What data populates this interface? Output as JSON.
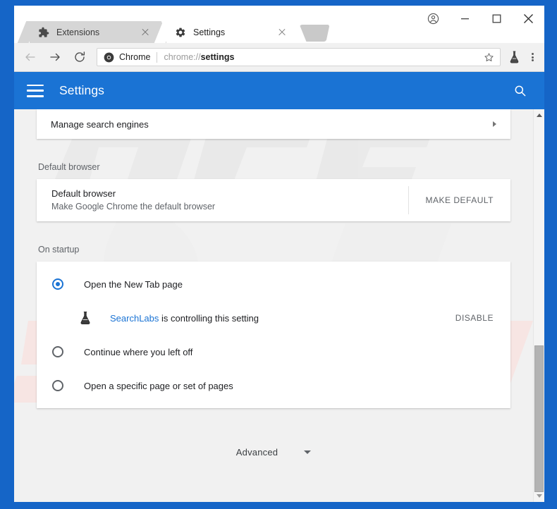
{
  "window": {
    "controls": {
      "profile": "profile-icon",
      "minimize": "minimize-button",
      "maximize": "maximize-button",
      "close": "close-button"
    }
  },
  "tabs": [
    {
      "title": "Extensions",
      "favicon": "puzzle-piece-icon",
      "active": false,
      "close": "×"
    },
    {
      "title": "Settings",
      "favicon": "gear-icon",
      "active": true,
      "close": "×"
    }
  ],
  "toolbar": {
    "back": "back-arrow-icon",
    "forward": "forward-arrow-icon",
    "reload": "reload-icon",
    "omnibox": {
      "chrome_logo": "chrome-logo-icon",
      "scheme_label": "Chrome",
      "url_prefix": "chrome://",
      "url_bold": "settings",
      "full_url": "chrome://settings",
      "star": "star-icon"
    },
    "extension_icon": "flask-extension-icon",
    "menu_icon": "three-dot-menu-icon"
  },
  "appbar": {
    "menu_icon": "hamburger-menu-icon",
    "title": "Settings",
    "search_icon": "search-icon"
  },
  "content": {
    "search_engines_row": {
      "label": "Manage search engines",
      "chevron": "chevron-right-icon"
    },
    "default_browser": {
      "section_title": "Default browser",
      "title": "Default browser",
      "subtitle": "Make Google Chrome the default browser",
      "button": "MAKE DEFAULT"
    },
    "on_startup": {
      "section_title": "On startup",
      "options": [
        {
          "label": "Open the New Tab page",
          "checked": true
        },
        {
          "label": "Continue where you left off",
          "checked": false
        },
        {
          "label": "Open a specific page or set of pages",
          "checked": false
        }
      ],
      "controlled": {
        "icon": "flask-icon",
        "link_text": "SearchLabs",
        "rest_text": " is controlling this setting",
        "button": "DISABLE"
      }
    },
    "advanced": {
      "label": "Advanced",
      "caret": "chevron-down-icon"
    }
  },
  "scrollbar": {
    "up_arrow": "scroll-up-arrow",
    "down_arrow": "scroll-down-arrow"
  },
  "watermark": {
    "text": "PCrisk.com"
  },
  "colors": {
    "frame_blue": "#1565c7",
    "appbar_blue": "#1a73d4",
    "accent_blue": "#1a73d4",
    "page_bg": "#f1f1f1",
    "card_bg": "#ffffff",
    "text_primary": "#202124",
    "text_secondary": "#5f6368"
  }
}
